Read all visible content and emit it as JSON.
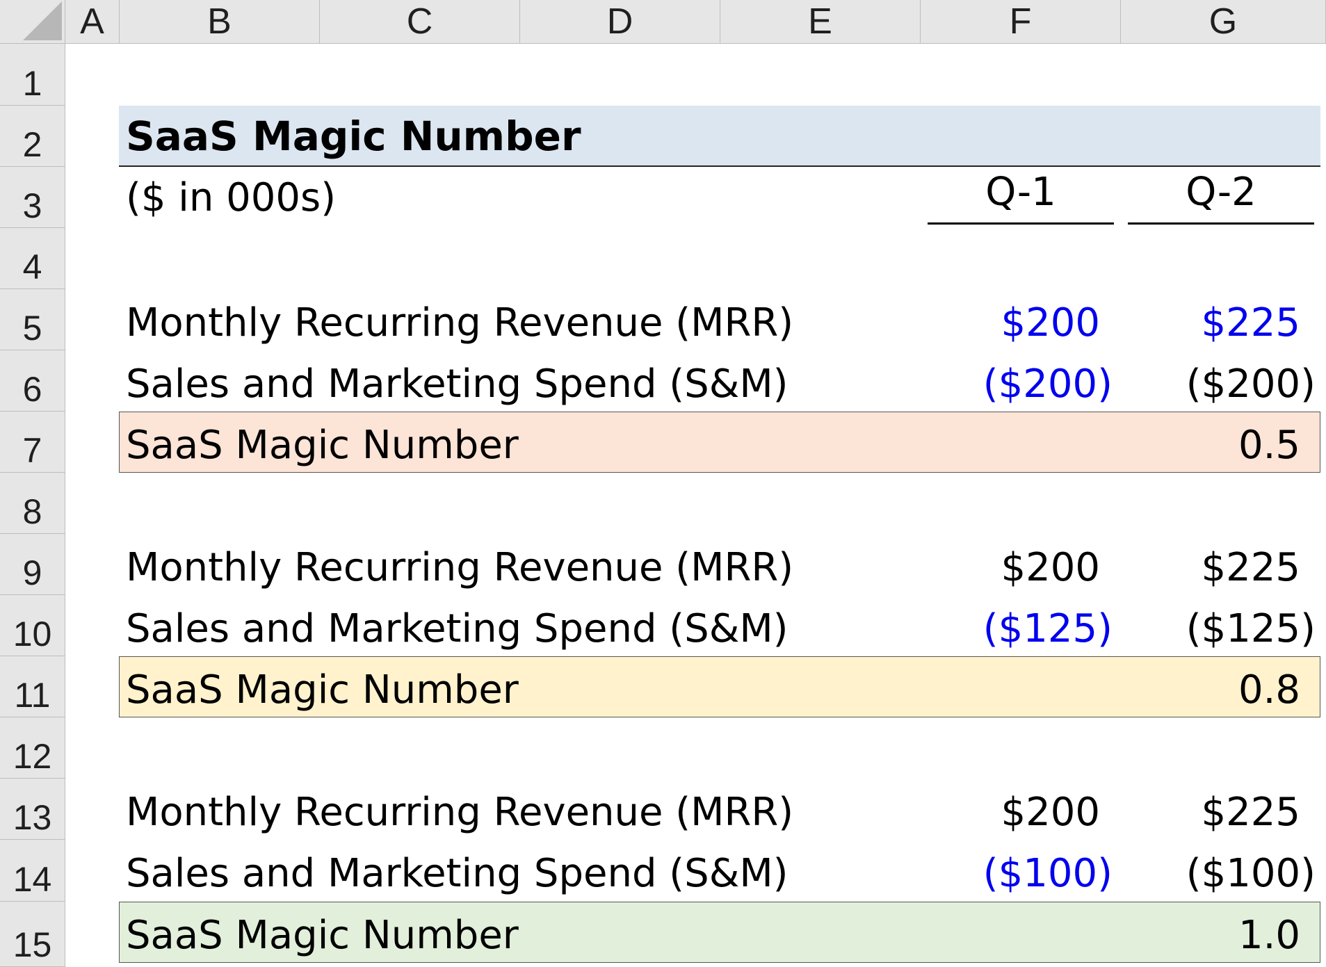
{
  "columns": [
    "A",
    "B",
    "C",
    "D",
    "E",
    "F",
    "G"
  ],
  "rows": [
    "1",
    "2",
    "3",
    "4",
    "5",
    "6",
    "7",
    "8",
    "9",
    "10",
    "11",
    "12",
    "13",
    "14",
    "15"
  ],
  "title": "SaaS Magic Number",
  "units": "($ in 000s)",
  "periods": [
    "Q-1",
    "Q-2"
  ],
  "blocks": [
    {
      "mrr_label": "Monthly Recurring Revenue (MRR)",
      "mrr_q1": "$200",
      "mrr_q2": "$225",
      "sm_label": "Sales and Marketing Spend (S&M)",
      "sm_q1": "($200)",
      "sm_q2": "($200)",
      "magic_label": "SaaS Magic Number",
      "magic_value": "0.5",
      "band_color": "#fce4d6"
    },
    {
      "mrr_label": "Monthly Recurring Revenue (MRR)",
      "mrr_q1": "$200",
      "mrr_q2": "$225",
      "sm_label": "Sales and Marketing Spend (S&M)",
      "sm_q1": "($125)",
      "sm_q2": "($125)",
      "magic_label": "SaaS Magic Number",
      "magic_value": "0.8",
      "band_color": "#fff2cc"
    },
    {
      "mrr_label": "Monthly Recurring Revenue (MRR)",
      "mrr_q1": "$200",
      "mrr_q2": "$225",
      "sm_label": "Sales and Marketing Spend (S&M)",
      "sm_q1": "($100)",
      "sm_q2": "($100)",
      "magic_label": "SaaS Magic Number",
      "magic_value": "1.0",
      "band_color": "#e2efda"
    }
  ],
  "colors": {
    "header_bg": "#e6e6e6",
    "title_band": "#dce6f1",
    "input_blue": "#0000ee"
  }
}
